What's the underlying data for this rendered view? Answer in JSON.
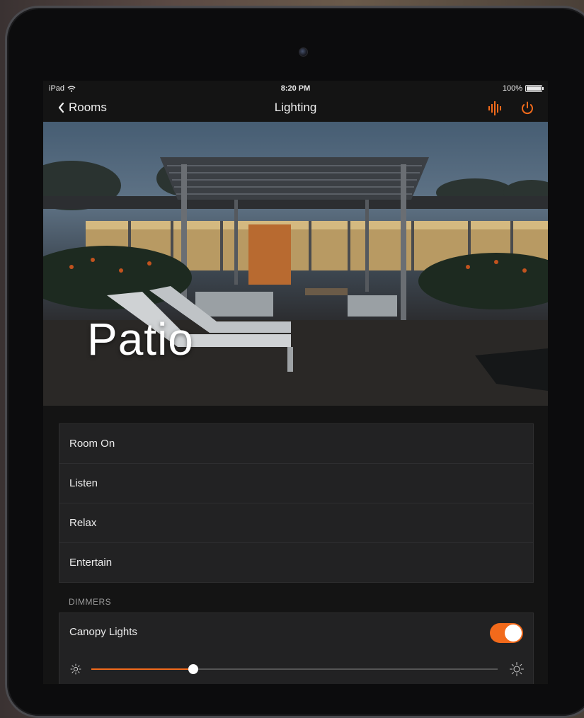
{
  "statusbar": {
    "device": "iPad",
    "time": "8:20 PM",
    "battery": "100%"
  },
  "navbar": {
    "back_label": "Rooms",
    "title": "Lighting"
  },
  "hero": {
    "room_name": "Patio"
  },
  "scenes": [
    {
      "label": "Room On"
    },
    {
      "label": "Listen"
    },
    {
      "label": "Relax"
    },
    {
      "label": "Entertain"
    }
  ],
  "dimmers": {
    "section_title": "DIMMERS",
    "items": [
      {
        "label": "Canopy Lights",
        "on": true,
        "level_percent": 25
      }
    ]
  },
  "colors": {
    "accent": "#f26a1b",
    "background": "#141414",
    "card": "#222223"
  },
  "icons": {
    "back": "chevron-left-icon",
    "voice": "audio-bars-icon",
    "power": "power-icon",
    "dim_low": "sun-small-icon",
    "dim_high": "sun-large-icon"
  }
}
